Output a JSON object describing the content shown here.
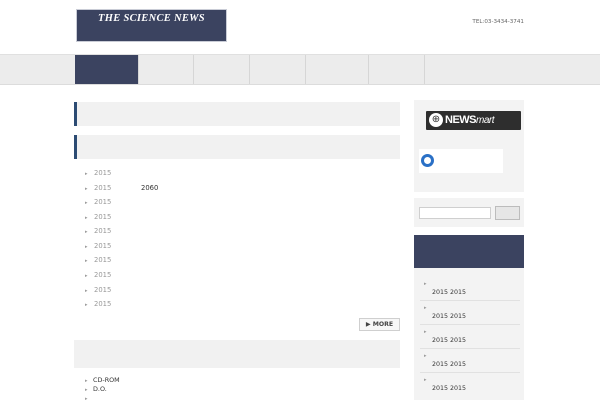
{
  "header": {
    "logo_line1": "THE SCIENCE NEWS",
    "logo_line2": "",
    "tagline": "",
    "contact": "TEL:03-3434-3741"
  },
  "nav": {
    "items": [
      "",
      "",
      "",
      "",
      "",
      ""
    ],
    "active_index": 0
  },
  "sections": {
    "first_heading": "",
    "news_heading": "",
    "more_label": "MORE",
    "bottom_heading": ""
  },
  "news": [
    {
      "date": "2015",
      "title": ""
    },
    {
      "date": "2015",
      "title": "2060"
    },
    {
      "date": "2015",
      "title": ""
    },
    {
      "date": "2015",
      "title": ""
    },
    {
      "date": "2015",
      "title": ""
    },
    {
      "date": "2015",
      "title": ""
    },
    {
      "date": "2015",
      "title": ""
    },
    {
      "date": "2015",
      "title": ""
    },
    {
      "date": "2015",
      "title": ""
    },
    {
      "date": "2015",
      "title": ""
    }
  ],
  "bottom_items": [
    "CD-ROM",
    "D.O.",
    ""
  ],
  "sidebar": {
    "newsmart_label": "",
    "newsmart_logo_bold": "NEWS",
    "newsmart_logo_italic": "mart",
    "nikkei_label": "",
    "nikkei_logo": "",
    "search_placeholder": "",
    "events_heading": "",
    "events": [
      {
        "title": "",
        "dates": "2015  2015"
      },
      {
        "title": "",
        "dates": "2015  2015"
      },
      {
        "title": "",
        "dates": "2015  2015"
      },
      {
        "title": "",
        "dates": "2015  2015"
      },
      {
        "title": "",
        "dates": "2015  2015"
      }
    ]
  },
  "colors": {
    "brand_navy": "#3b4360",
    "accent_blue": "#2c4b73",
    "nikkei_blue": "#2a70c6"
  },
  "icons": {
    "newsmart": "globe-icon",
    "nikkei": "nikkei-logo-mark",
    "bullet": "triangle-bullet-icon"
  }
}
